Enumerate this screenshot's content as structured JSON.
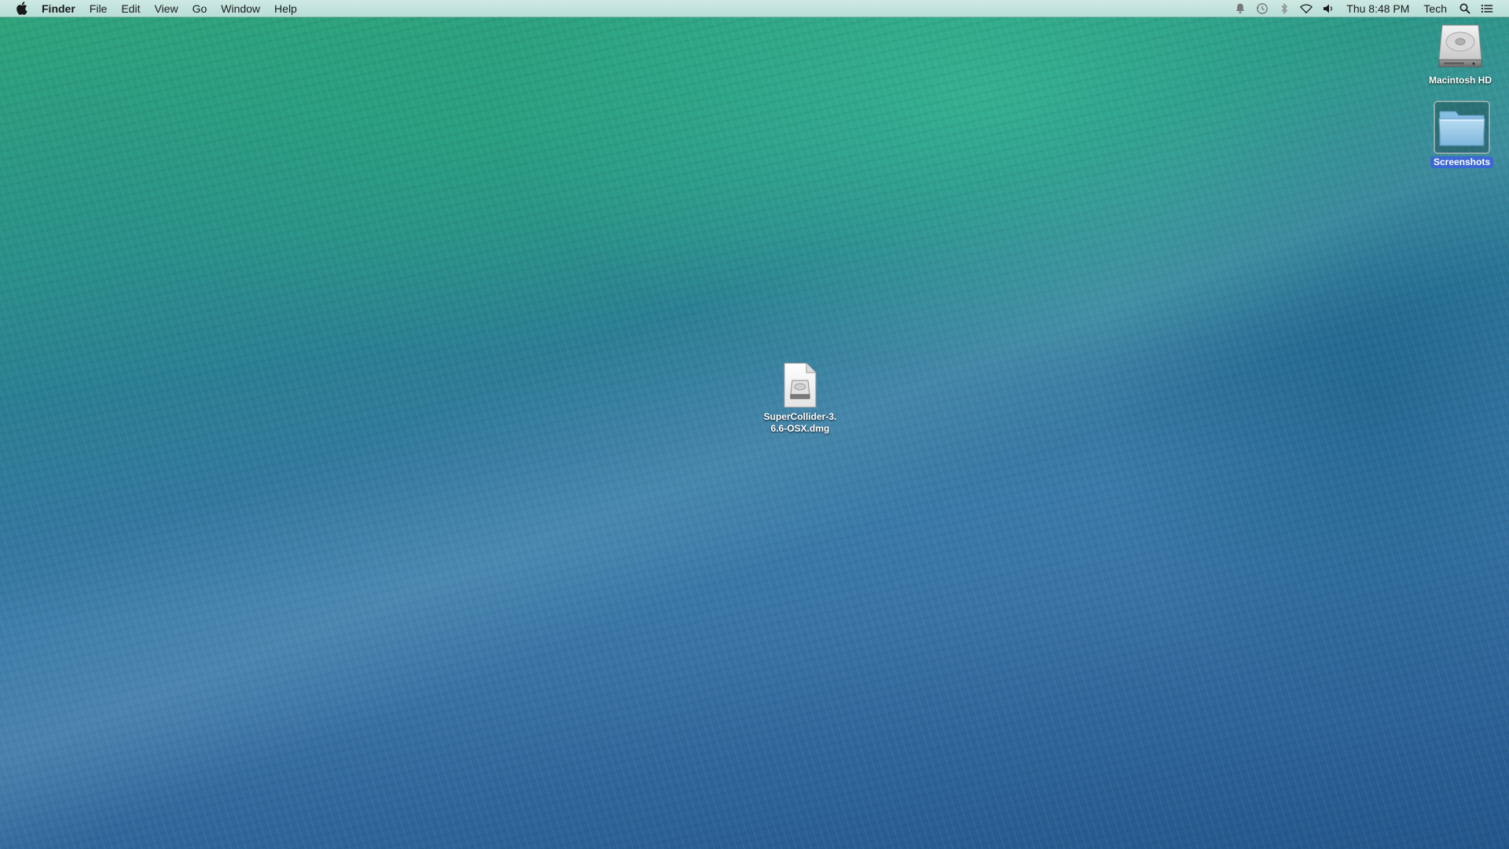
{
  "menubar": {
    "apple_icon": "apple-icon",
    "app_name": "Finder",
    "menus": [
      "File",
      "Edit",
      "View",
      "Go",
      "Window",
      "Help"
    ],
    "status_icons": [
      "notification-bell-icon",
      "time-machine-icon",
      "bluetooth-icon",
      "wifi-icon",
      "volume-icon"
    ],
    "clock": "Thu 8:48 PM",
    "user": "Tech",
    "spotlight_icon": "search-icon",
    "notification_center_icon": "list-icon"
  },
  "desktop": {
    "wallpaper": "ocean wave",
    "icons": [
      {
        "label": "Macintosh HD",
        "icon": "hard-drive-icon",
        "selected": false
      },
      {
        "label": "Screenshots",
        "icon": "folder-icon",
        "selected": true
      },
      {
        "label": "SuperCollider-3.6.6-OSX.dmg",
        "icon": "dmg-file-icon",
        "selected": false
      }
    ]
  },
  "colors": {
    "menubar_bg": "#c4e4dd",
    "selection_blue": "#3c67d4"
  }
}
